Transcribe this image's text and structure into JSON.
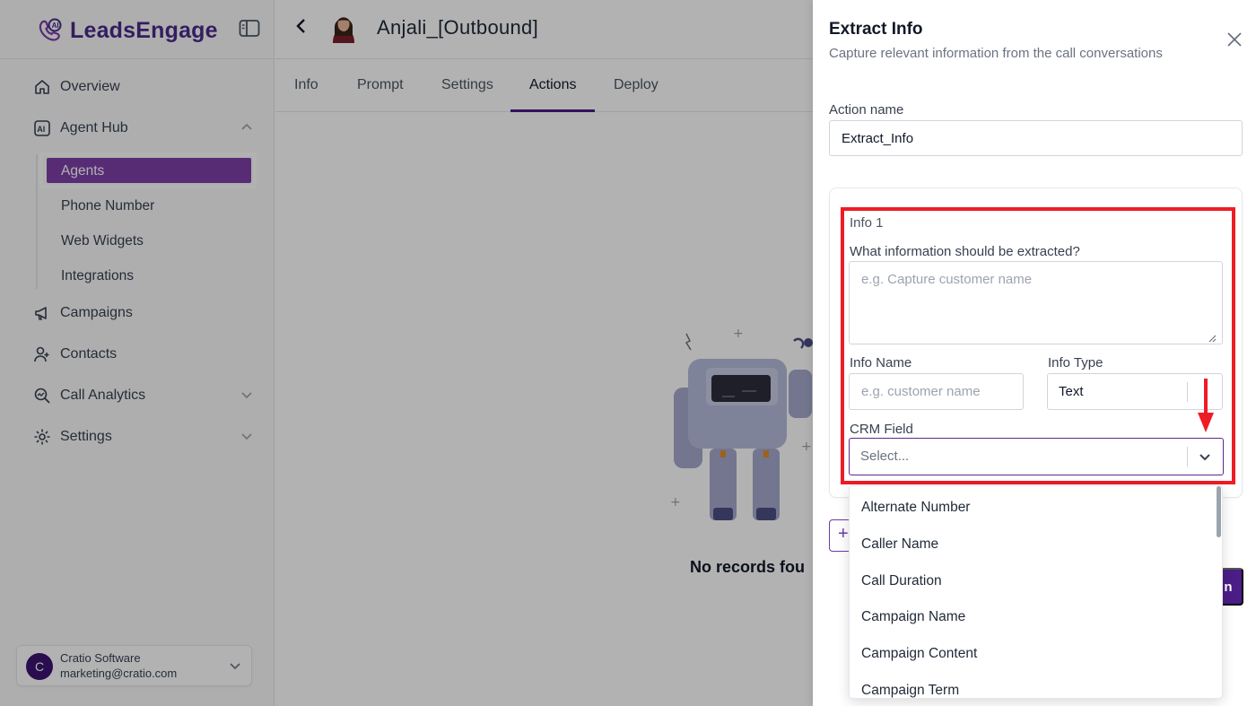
{
  "brand": {
    "name": "LeadsEngage",
    "accent": "#4b2a8a",
    "primary": "#4b1d86"
  },
  "sidebar": {
    "items": [
      {
        "label": "Overview",
        "icon": "home-icon"
      },
      {
        "label": "Agent Hub",
        "icon": "ai-agent-icon",
        "expanded": true
      },
      {
        "label": "Campaigns",
        "icon": "megaphone-icon"
      },
      {
        "label": "Contacts",
        "icon": "user-plus-icon"
      },
      {
        "label": "Call Analytics",
        "icon": "analytics-icon"
      },
      {
        "label": "Settings",
        "icon": "gear-icon"
      }
    ],
    "agent_hub_sub": [
      "Agents",
      "Phone Number",
      "Web Widgets",
      "Integrations"
    ],
    "active_sub": "Agents",
    "user": {
      "initial": "C",
      "name": "Cratio Software",
      "email": "marketing@cratio.com"
    }
  },
  "header": {
    "agent_name": "Anjali_[Outbound]"
  },
  "tabs": [
    "Info",
    "Prompt",
    "Settings",
    "Actions",
    "Deploy"
  ],
  "active_tab": "Actions",
  "empty_state": {
    "text": "No records fou"
  },
  "drawer": {
    "title": "Extract Info",
    "subtitle": "Capture relevant information from the call conversations",
    "action_name_label": "Action name",
    "action_name_value": "Extract_Info",
    "info_block": {
      "heading": "Info 1",
      "question_label": "What information should be extracted?",
      "question_placeholder": "e.g. Capture customer name",
      "info_name_label": "Info Name",
      "info_name_placeholder": "e.g. customer name",
      "info_type_label": "Info Type",
      "info_type_value": "Text",
      "crm_field_label": "CRM Field",
      "crm_field_placeholder": "Select..."
    },
    "save_fragment": "n",
    "add_fragment": "+"
  },
  "crm_options": [
    "Alternate Number",
    "Caller Name",
    "Call Duration",
    "Campaign Name",
    "Campaign Content",
    "Campaign Term"
  ],
  "annotation_color": "#ee1c25"
}
